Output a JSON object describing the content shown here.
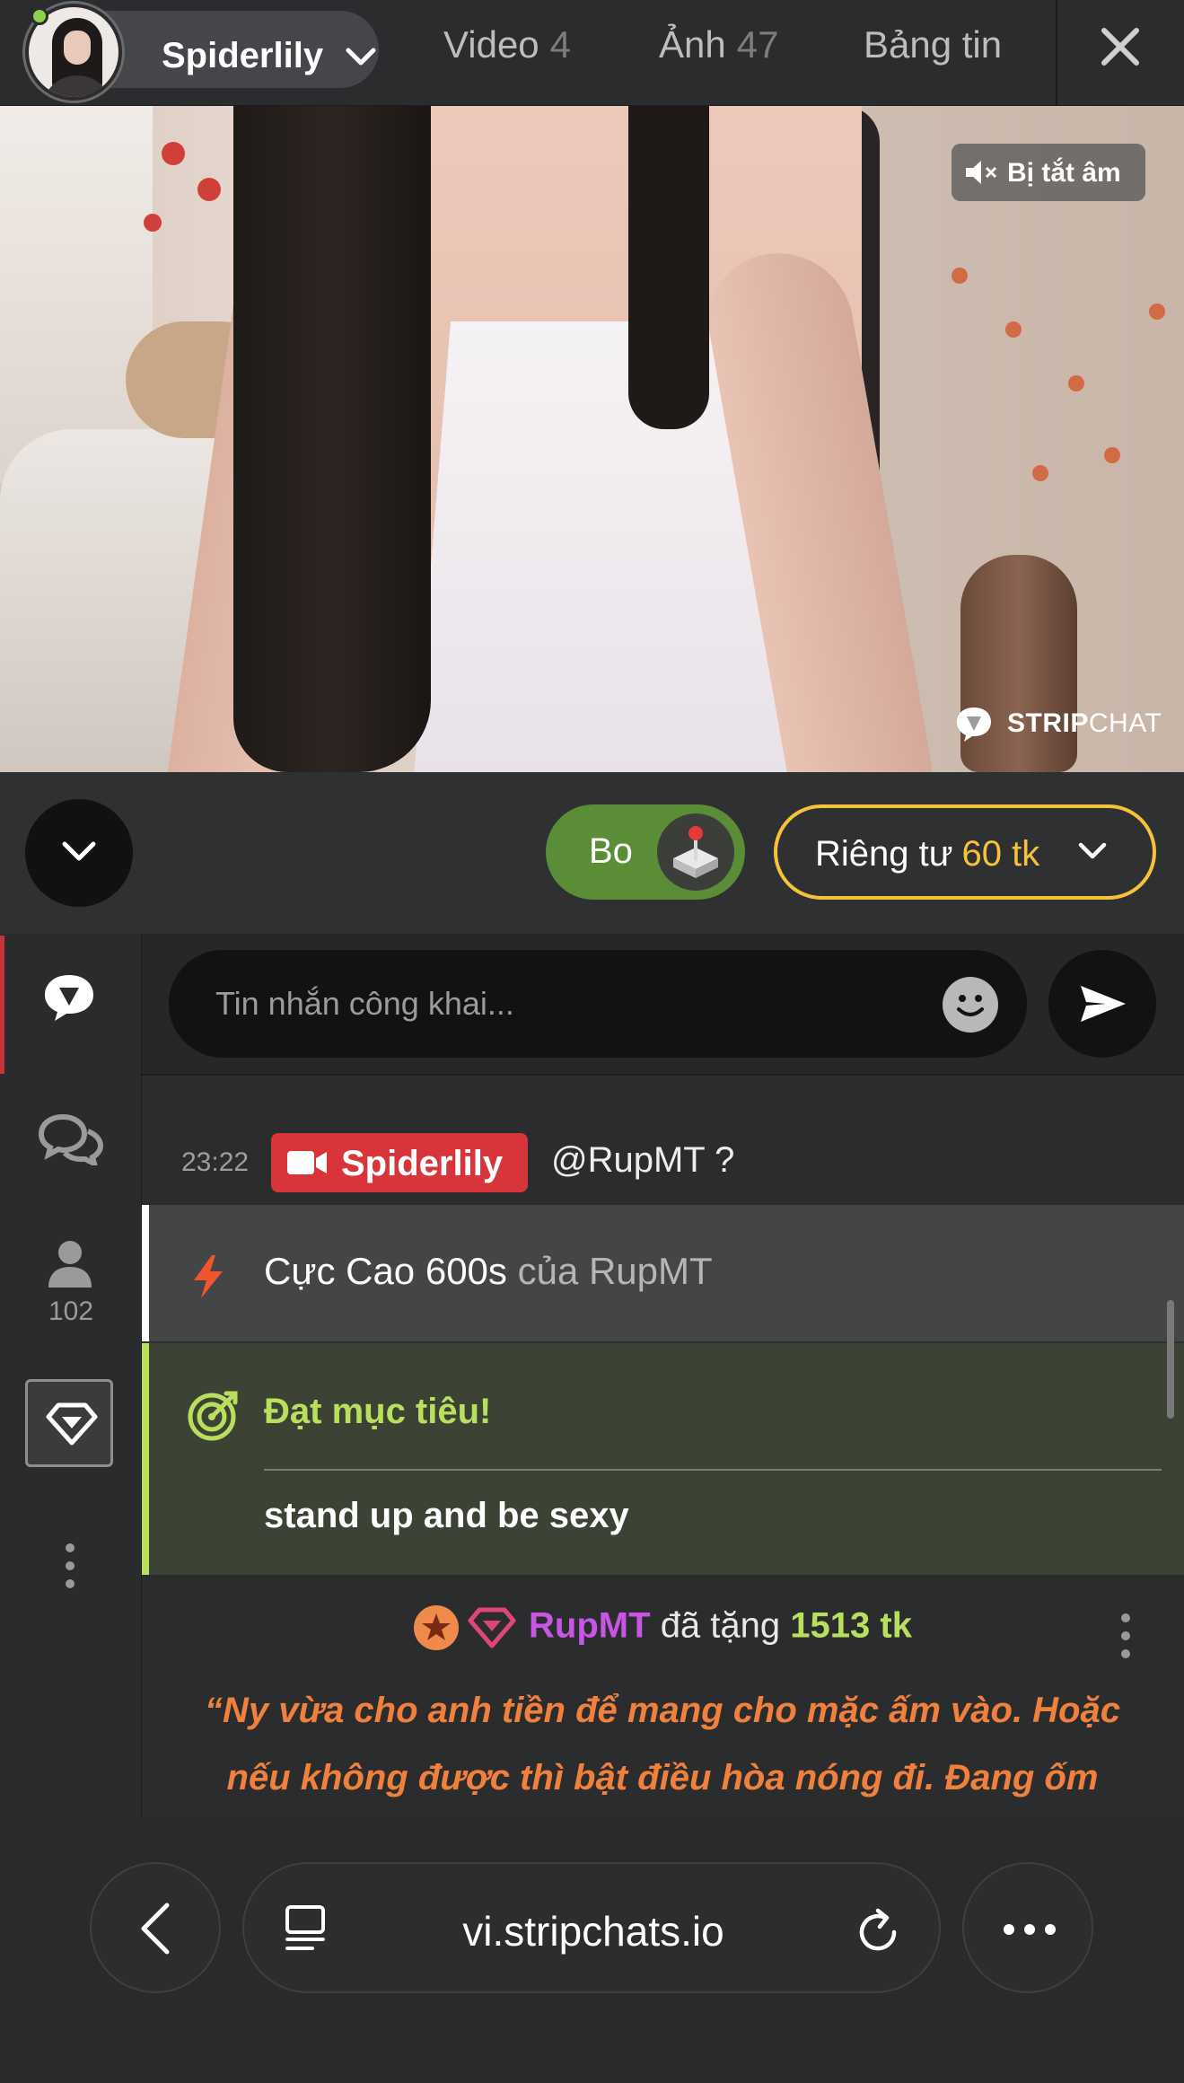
{
  "header": {
    "model_name": "Spiderlily",
    "tabs": [
      {
        "label": "Video",
        "count": "4"
      },
      {
        "label": "Ảnh",
        "count": "47"
      },
      {
        "label": "Bảng tin",
        "count": ""
      }
    ],
    "close_icon": "close-icon"
  },
  "video": {
    "mute_label": "Bị tắt âm",
    "watermark_bold": "STRIP",
    "watermark_rest": "CHAT"
  },
  "controls": {
    "tip_label": "Bo",
    "private_label": "Riêng tư",
    "private_price": "60 tk"
  },
  "rail": {
    "users_count": "102"
  },
  "chat": {
    "input_placeholder": "Tin nhắn công khai...",
    "messages": [
      {
        "time": "23:22",
        "author": "Spiderlily",
        "text": "@RupMT  ?"
      }
    ],
    "event": {
      "strong": "Cực Cao 600s",
      "rest": "của RupMT"
    },
    "goal": {
      "title": "Đạt mục tiêu!",
      "text": "stand up and be sexy"
    },
    "tip": {
      "user": "RupMT",
      "verb": "đã tặng",
      "amount": "1513 tk",
      "message": "“Ny vừa cho anh tiền để mang cho mặc ấm vào. Hoặc nếu không được thì bật điều hòa nóng đi. Đang ốm đừng để lạnh bé nhé”"
    }
  },
  "browser": {
    "url": "vi.stripchats.io"
  },
  "colors": {
    "accent_red": "#d8353b",
    "tip_green": "#5a8d36",
    "private_gold": "#f6c23a",
    "goal_green": "#b8e05c",
    "tipper_purple": "#c855e3",
    "tip_message_orange": "#f0803c"
  }
}
